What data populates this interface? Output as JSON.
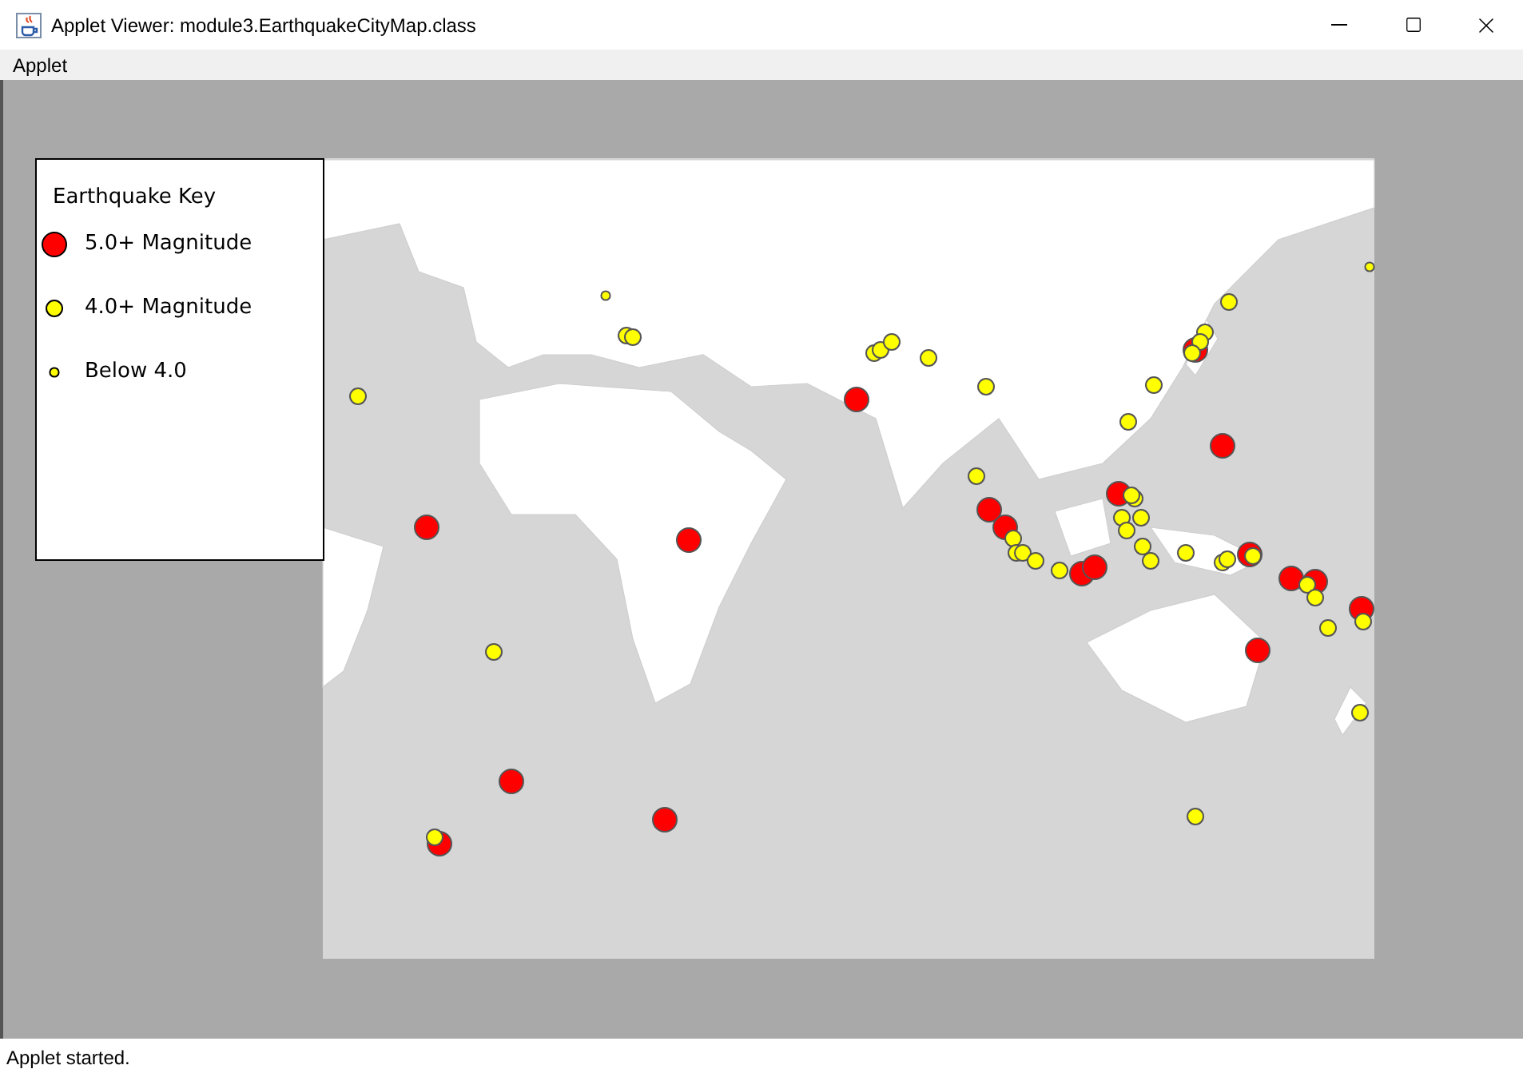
{
  "window": {
    "title": "Applet Viewer: module3.EarthquakeCityMap.class"
  },
  "menu": [
    {
      "label": "Applet"
    }
  ],
  "legend": {
    "title": "Earthquake Key",
    "items": [
      {
        "kind": "large",
        "label": "5.0+ Magnitude"
      },
      {
        "kind": "medium",
        "label": "4.0+ Magnitude"
      },
      {
        "kind": "small",
        "label": "Below 4.0"
      }
    ]
  },
  "status_bar": "Applet started."
}
